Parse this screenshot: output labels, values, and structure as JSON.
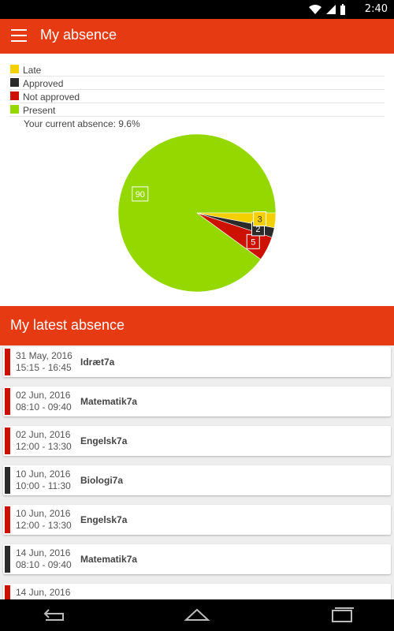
{
  "status": {
    "time": "2:40"
  },
  "appbar": {
    "title": "My absence"
  },
  "legend": [
    {
      "label": "Late",
      "color": "#f5d000"
    },
    {
      "label": "Approved",
      "color": "#2a2a2a"
    },
    {
      "label": "Not approved",
      "color": "#cc1100"
    },
    {
      "label": "Present",
      "color": "#94d800"
    }
  ],
  "summary": "Your current absence: 9.6%",
  "chart_data": {
    "type": "pie",
    "slices": [
      {
        "name": "Present",
        "value": 90,
        "color": "#94d800",
        "label": "90"
      },
      {
        "name": "Not approved",
        "value": 5,
        "color": "#cc1100",
        "label": "5"
      },
      {
        "name": "Approved",
        "value": 2,
        "color": "#2a2a2a",
        "label": "2"
      },
      {
        "name": "Late",
        "value": 3,
        "color": "#f5d000",
        "label": "3"
      }
    ]
  },
  "section": {
    "title": "My latest absence"
  },
  "absences": [
    {
      "date": "31 May, 2016",
      "time": "15:15 - 16:45",
      "subject": "Idræt7a",
      "color": "#cc1100"
    },
    {
      "date": "02 Jun, 2016",
      "time": "08:10 - 09:40",
      "subject": "Matematik7a",
      "color": "#cc1100"
    },
    {
      "date": "02 Jun, 2016",
      "time": "12:00 - 13:30",
      "subject": "Engelsk7a",
      "color": "#cc1100"
    },
    {
      "date": "10 Jun, 2016",
      "time": "10:00 - 11:30",
      "subject": "Biologi7a",
      "color": "#2a2a2a"
    },
    {
      "date": "10 Jun, 2016",
      "time": "12:00 - 13:30",
      "subject": "Engelsk7a",
      "color": "#cc1100"
    },
    {
      "date": "14 Jun, 2016",
      "time": "08:10 - 09:40",
      "subject": "Matematik7a",
      "color": "#2a2a2a"
    },
    {
      "date": "14 Jun, 2016",
      "time": "",
      "subject": "",
      "color": "#cc1100"
    }
  ],
  "icons": {
    "menu": "hamburger-menu-icon",
    "wifi": "wifi-icon",
    "signal": "cell-signal-icon",
    "battery": "battery-icon",
    "back": "back-icon",
    "home": "home-icon",
    "recents": "recents-icon"
  }
}
